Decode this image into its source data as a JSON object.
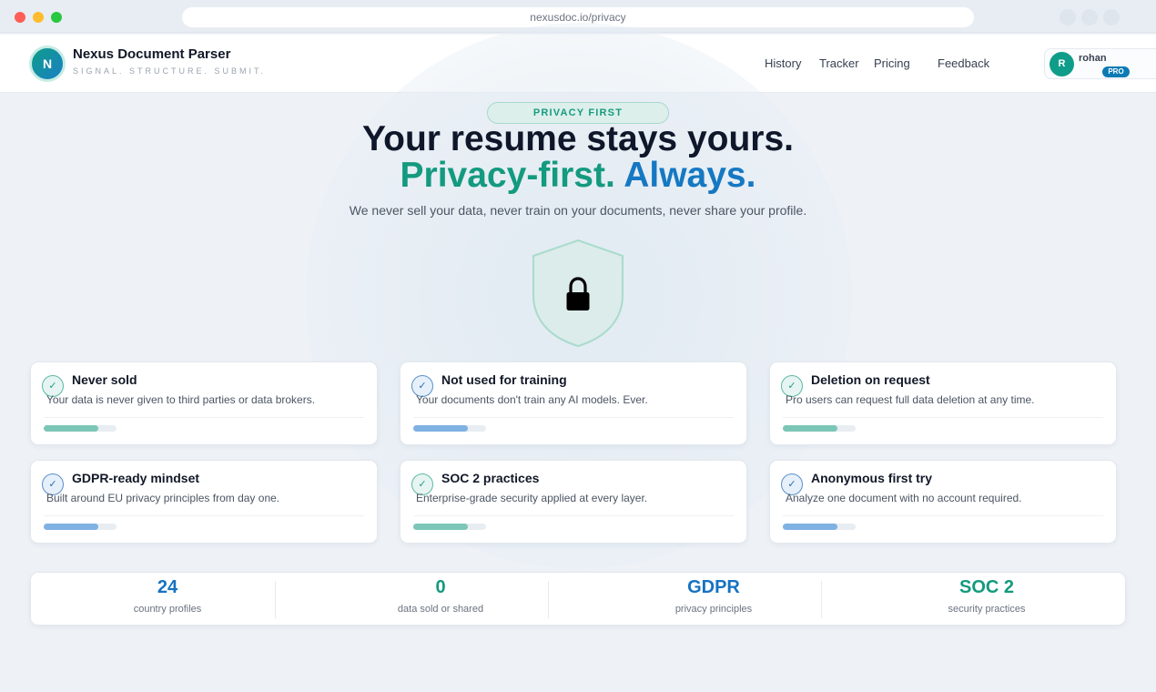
{
  "browser": {
    "url": "nexusdoc.io/privacy"
  },
  "brand": {
    "logo_letter": "N",
    "name": "Nexus Document Parser",
    "tagline": "SIGNAL. STRUCTURE. SUBMIT."
  },
  "nav": {
    "history": "History",
    "tracker": "Tracker",
    "pricing": "Pricing",
    "feedback": "Feedback"
  },
  "user": {
    "initial": "R",
    "name": "rohan",
    "badge": "PRO"
  },
  "hero": {
    "pill": "PRIVACY FIRST",
    "title_line1": "Your resume stays yours.",
    "title_line2_a": "Privacy-first.",
    "title_line2_b": "Always.",
    "subtitle": "We never sell your data, never train on your documents, never share your profile.",
    "icon": "shield-lock-icon"
  },
  "cards": [
    {
      "title": "Never sold",
      "desc": "Your data is never given to third parties or data brokers.",
      "accent": "teal",
      "progress": 0.75
    },
    {
      "title": "Not used for training",
      "desc": "Your documents don't train any AI models. Ever.",
      "accent": "blue",
      "progress": 0.75
    },
    {
      "title": "Deletion on request",
      "desc": "Pro users can request full data deletion at any time.",
      "accent": "teal",
      "progress": 0.75
    },
    {
      "title": "GDPR-ready mindset",
      "desc": "Built around EU privacy principles from day one.",
      "accent": "blue",
      "progress": 0.75
    },
    {
      "title": "SOC 2 practices",
      "desc": "Enterprise-grade security applied at every layer.",
      "accent": "teal",
      "progress": 0.75
    },
    {
      "title": "Anonymous first try",
      "desc": "Analyze one document with no account required.",
      "accent": "blue",
      "progress": 0.75
    }
  ],
  "check_glyph": "✓",
  "stats": [
    {
      "value": "24",
      "label": "country profiles",
      "color": "#1672c2"
    },
    {
      "value": "0",
      "label": "data sold or shared",
      "color": "#139a7f"
    },
    {
      "value": "GDPR",
      "label": "privacy principles",
      "color": "#1672c2"
    },
    {
      "value": "SOC 2",
      "label": "security practices",
      "color": "#139a7f"
    }
  ],
  "colors": {
    "teal": "#139a7f",
    "blue": "#1678c2",
    "background": "#eef2f7"
  }
}
